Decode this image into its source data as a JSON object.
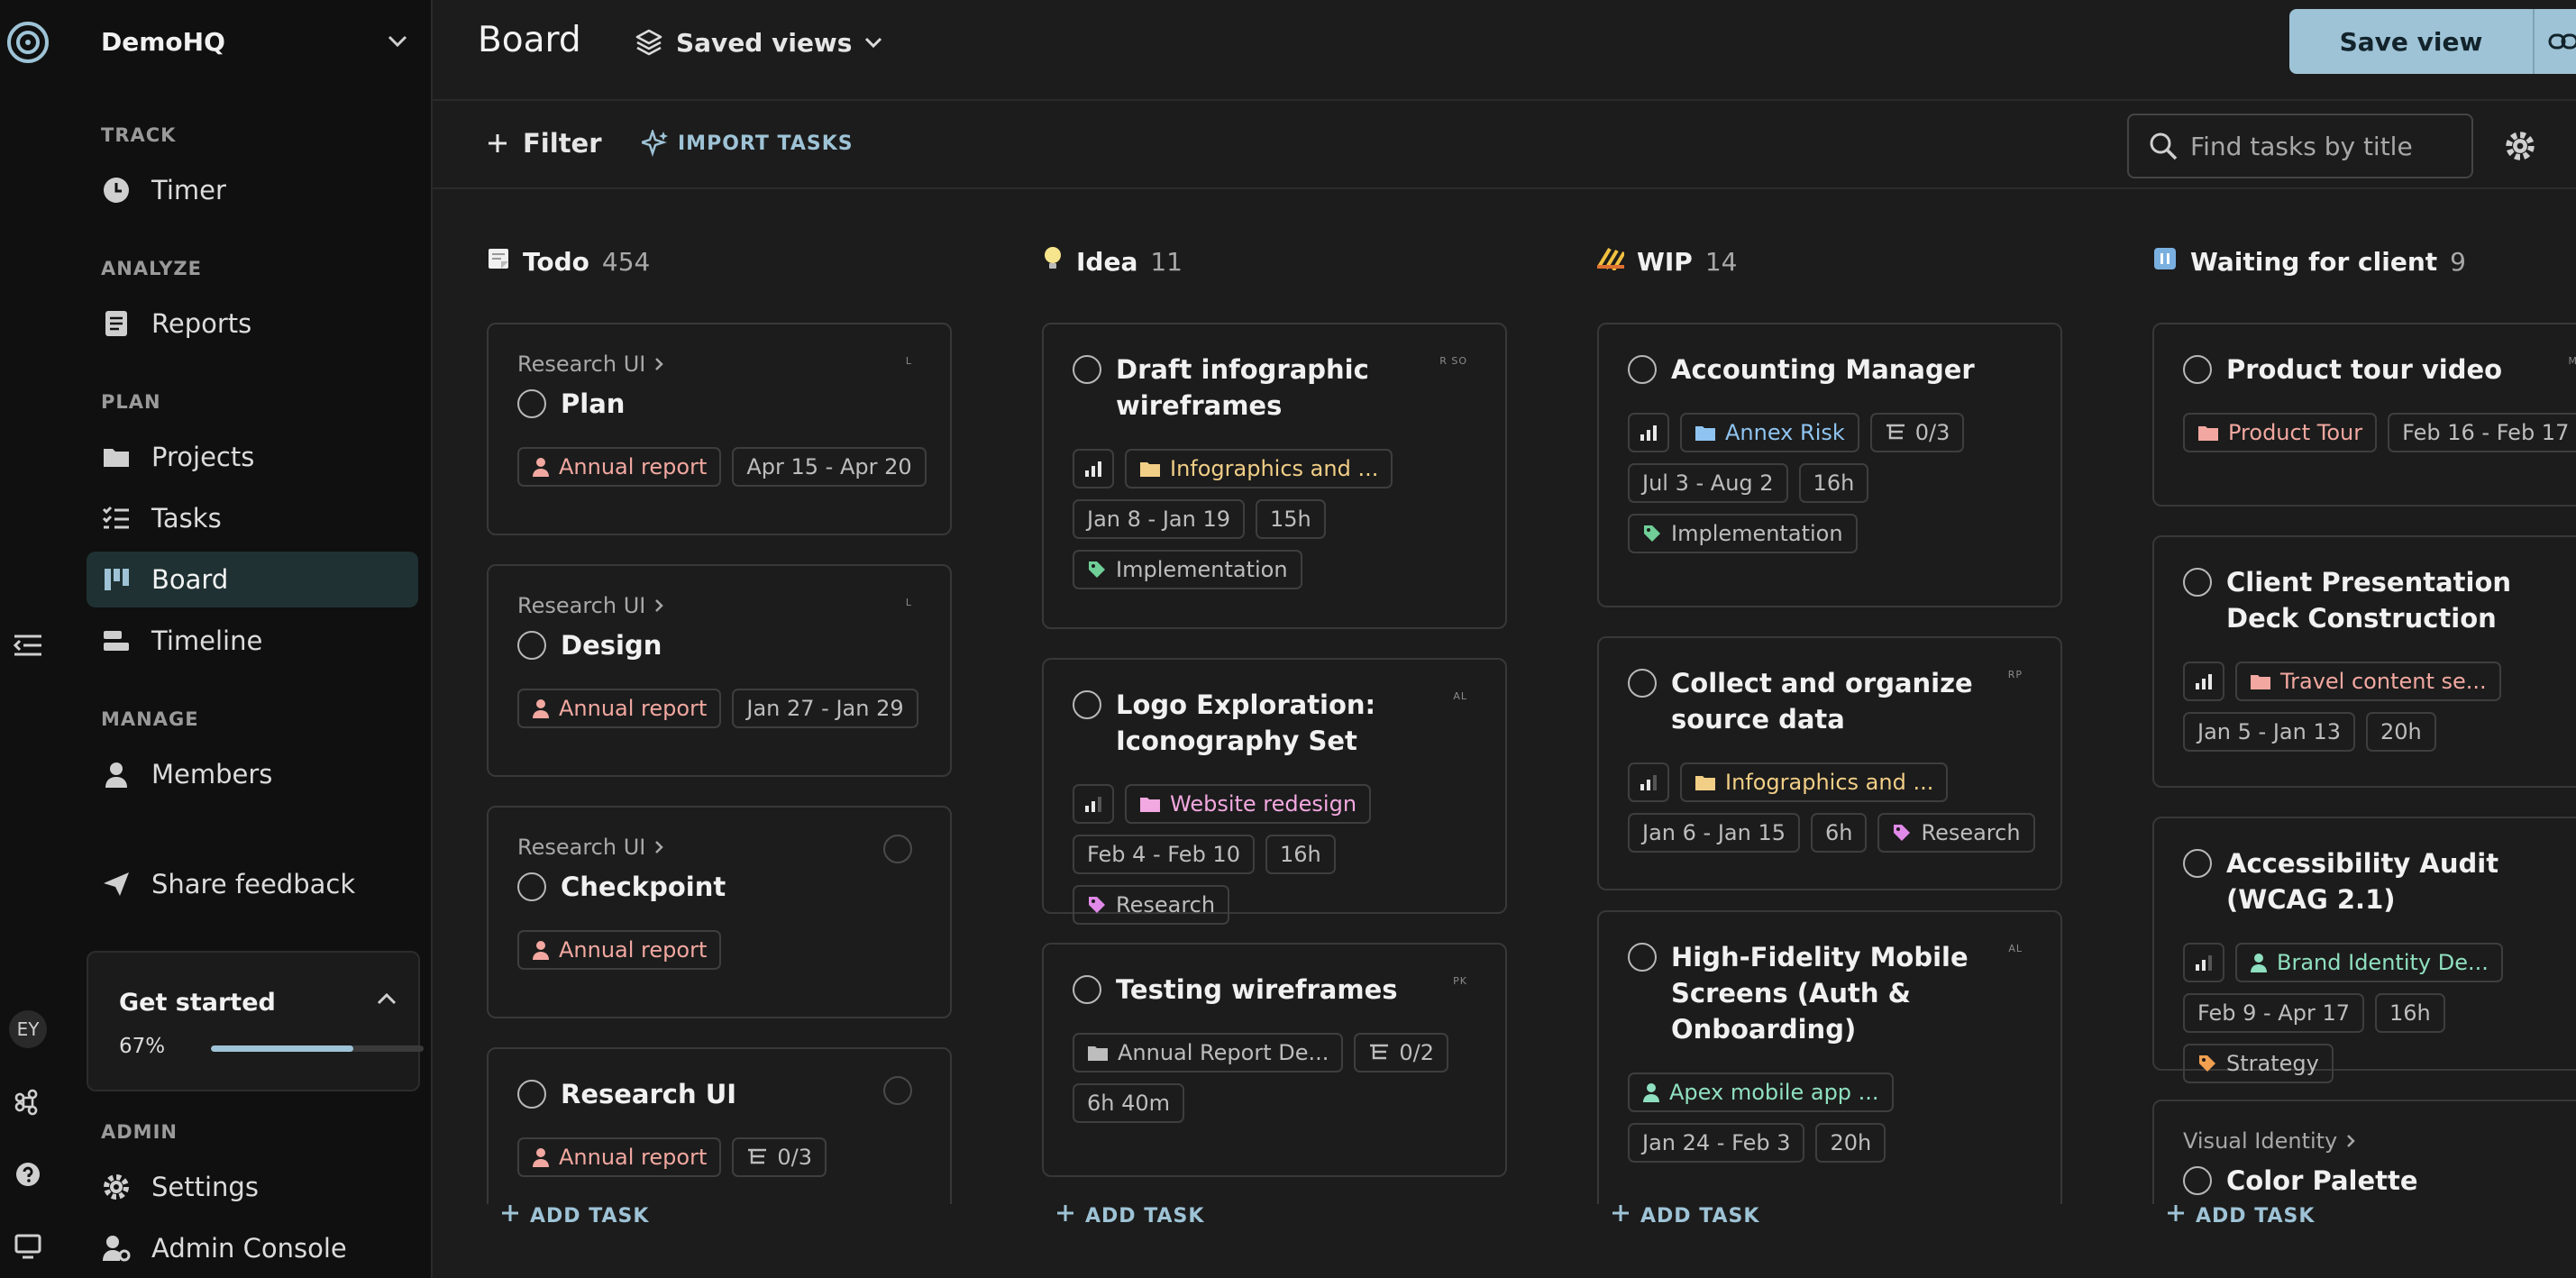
{
  "rail": {
    "avatar_initials": "EY"
  },
  "sidebar": {
    "workspace": "DemoHQ",
    "sections": {
      "track": "TRACK",
      "analyze": "ANALYZE",
      "plan": "PLAN",
      "manage": "MANAGE",
      "admin": "ADMIN"
    },
    "items": {
      "timer": "Timer",
      "reports": "Reports",
      "projects": "Projects",
      "tasks": "Tasks",
      "board": "Board",
      "timeline": "Timeline",
      "members": "Members",
      "share_feedback": "Share feedback",
      "settings": "Settings",
      "admin_console": "Admin Console"
    },
    "get_started": {
      "title": "Get started",
      "percent_label": "67%",
      "progress": 0.67
    }
  },
  "header": {
    "title": "Board",
    "saved_views": "Saved views",
    "save_view": "Save view"
  },
  "toolbar": {
    "filter": "Filter",
    "import": "IMPORT TASKS",
    "search_placeholder": "Find tasks by title"
  },
  "colors": {
    "accent": "#9ec3d6",
    "sidebar_active": "#1f3133"
  },
  "columns": [
    {
      "name": "Todo",
      "count": "454",
      "add_task": "ADD TASK",
      "cards": [
        {
          "parent": "Research UI",
          "title": "Plan",
          "initials": "L",
          "tags": [
            {
              "text": "Annual report",
              "color": "#f2a8a0",
              "icon": "person"
            },
            {
              "text": "Apr 15 - Apr 20"
            }
          ]
        },
        {
          "parent": "Research UI",
          "title": "Design",
          "initials": "L",
          "tags": [
            {
              "text": "Annual report",
              "color": "#f2a8a0",
              "icon": "person"
            },
            {
              "text": "Jan 27 - Jan 29"
            }
          ]
        },
        {
          "parent": "Research UI",
          "title": "Checkpoint",
          "initials": "",
          "tags": [
            {
              "text": "Annual report",
              "color": "#f2a8a0",
              "icon": "person"
            }
          ]
        },
        {
          "parent": "",
          "title": "Research UI",
          "initials": "",
          "tags": [
            {
              "text": "Annual report",
              "color": "#f2a8a0",
              "icon": "person"
            },
            {
              "text": "0/3",
              "icon": "subtask"
            }
          ]
        }
      ]
    },
    {
      "name": "Idea",
      "count": "11",
      "add_task": "ADD TASK",
      "cards": [
        {
          "parent": "",
          "title": "Draft infographic wireframes",
          "initials": "R SO",
          "tags": [
            {
              "icon": "priority-high"
            },
            {
              "text": "Infographics and ...",
              "color": "#f2cf86",
              "icon": "folder"
            },
            {
              "text": "Jan 8 - Jan 19"
            },
            {
              "text": "15h"
            },
            {
              "text": "Implementation",
              "color": "#bdbdbd",
              "icon": "tag",
              "icon_color": "#6fcf97"
            }
          ]
        },
        {
          "parent": "",
          "title": "Logo Exploration: Iconography Set",
          "initials": "AL",
          "tags": [
            {
              "icon": "priority-medium"
            },
            {
              "text": "Website redesign",
              "color": "#f2a8e0",
              "icon": "folder"
            },
            {
              "text": "Feb 4 - Feb 10"
            },
            {
              "text": "16h"
            },
            {
              "text": "Research",
              "color": "#bdbdbd",
              "icon": "tag",
              "icon_color": "#e08ae8"
            }
          ]
        },
        {
          "parent": "",
          "title": "Testing wireframes",
          "initials": "PK",
          "tags": [
            {
              "text": "Annual Report De...",
              "color": "#bdbdbd",
              "icon": "folder"
            },
            {
              "text": "0/2",
              "icon": "subtask"
            },
            {
              "text": "6h 40m"
            }
          ]
        }
      ]
    },
    {
      "name": "WIP",
      "count": "14",
      "add_task": "ADD TASK",
      "cards": [
        {
          "parent": "",
          "title": "Accounting Manager",
          "initials": "",
          "tags": [
            {
              "icon": "priority-high"
            },
            {
              "text": "Annex Risk",
              "color": "#8fc4f0",
              "icon": "folder"
            },
            {
              "text": "0/3",
              "icon": "subtask"
            },
            {
              "text": "Jul 3 - Aug 2"
            },
            {
              "text": "16h"
            },
            {
              "text": "Implementation",
              "color": "#bdbdbd",
              "icon": "tag",
              "icon_color": "#6fcf97"
            }
          ]
        },
        {
          "parent": "",
          "title": "Collect and organize source data",
          "initials": "RP",
          "tags": [
            {
              "icon": "priority-medium"
            },
            {
              "text": "Infographics and ...",
              "color": "#f2cf86",
              "icon": "folder"
            },
            {
              "text": "Jan 6 - Jan 15"
            },
            {
              "text": "6h"
            },
            {
              "text": "Research",
              "color": "#bdbdbd",
              "icon": "tag",
              "icon_color": "#e08ae8"
            }
          ]
        },
        {
          "parent": "",
          "title": "High-Fidelity Mobile Screens (Auth & Onboarding)",
          "initials": "AL",
          "tags": [
            {
              "text": "Apex mobile app ...",
              "color": "#8fe0c0",
              "icon": "person"
            },
            {
              "text": "Jan 24 - Feb 3"
            },
            {
              "text": "20h"
            }
          ]
        }
      ]
    },
    {
      "name": "Waiting for client",
      "count": "9",
      "add_task": "ADD TASK",
      "cards": [
        {
          "parent": "",
          "title": "Product tour video",
          "initials": "M",
          "tags": [
            {
              "text": "Product Tour",
              "color": "#f2a8a0",
              "icon": "folder"
            },
            {
              "text": "Feb 16 - Feb 17"
            }
          ]
        },
        {
          "parent": "",
          "title": "Client Presentation Deck Construction",
          "initials": "",
          "tags": [
            {
              "icon": "priority-high"
            },
            {
              "text": "Travel content se...",
              "color": "#f2a8a0",
              "icon": "folder"
            },
            {
              "text": "Jan 5 - Jan 13"
            },
            {
              "text": "20h"
            }
          ]
        },
        {
          "parent": "",
          "title": "Accessibility Audit (WCAG 2.1)",
          "initials": "",
          "tags": [
            {
              "icon": "priority-medium"
            },
            {
              "text": "Brand Identity De...",
              "color": "#8fe0c0",
              "icon": "person"
            },
            {
              "text": "Feb 9 - Apr 17"
            },
            {
              "text": "16h"
            },
            {
              "text": "Strategy",
              "color": "#bdbdbd",
              "icon": "tag",
              "icon_color": "#f0a050"
            }
          ]
        },
        {
          "parent": "Visual Identity",
          "title": "Color Palette Development",
          "initials": "",
          "tags": []
        }
      ]
    }
  ]
}
